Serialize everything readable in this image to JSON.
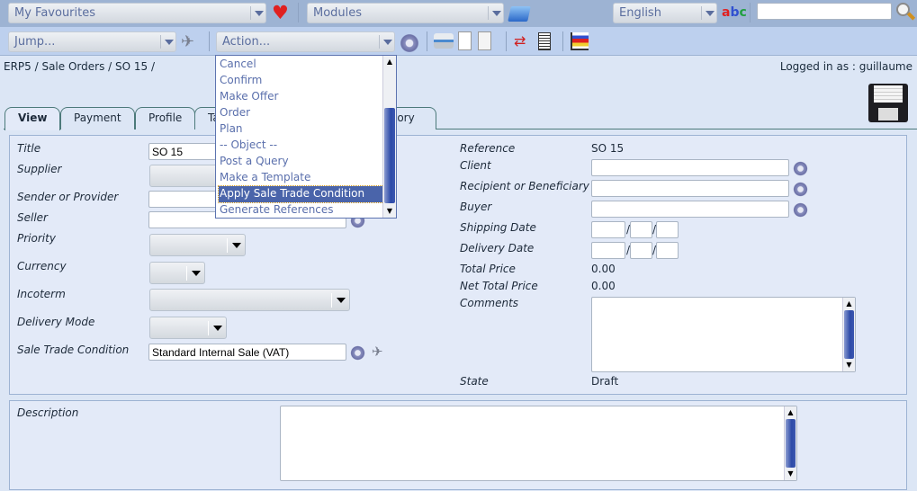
{
  "topbar": {
    "favourites": "My Favourites",
    "modules": "Modules",
    "language": "English",
    "search_value": ""
  },
  "toolbar": {
    "jump": "Jump...",
    "action": "Action..."
  },
  "breadcrumb": "ERP5 / Sale Orders / SO 15 /",
  "logged_in": "Logged in as : guillaume",
  "tabs": [
    {
      "label": "View",
      "active": true
    },
    {
      "label": "Payment"
    },
    {
      "label": "Profile"
    },
    {
      "label": "Ta"
    },
    {
      "label": "History"
    }
  ],
  "action_menu": {
    "items": [
      "Cancel",
      "Confirm",
      "Make Offer",
      "Order",
      "Plan",
      "-- Object --",
      "Post a Query",
      "Make a Template",
      "Apply Sale Trade Condition",
      "Generate References"
    ],
    "selected": "Apply Sale Trade Condition"
  },
  "form_left": {
    "title_label": "Title",
    "title_value": "SO 15",
    "supplier_label": "Supplier",
    "sender_label": "Sender or Provider",
    "seller_label": "Seller",
    "priority_label": "Priority",
    "currency_label": "Currency",
    "incoterm_label": "Incoterm",
    "delivery_mode_label": "Delivery Mode",
    "stc_label": "Sale Trade Condition",
    "stc_value": "Standard Internal Sale (VAT)"
  },
  "form_right": {
    "reference_label": "Reference",
    "reference_value": "SO 15",
    "client_label": "Client",
    "recipient_label": "Recipient or Beneficiary",
    "buyer_label": "Buyer",
    "shipping_label": "Shipping Date",
    "delivery_label": "Delivery Date",
    "date_sep": "/",
    "total_label": "Total Price",
    "total_value": "0.00",
    "net_label": "Net Total Price",
    "net_value": "0.00",
    "comments_label": "Comments",
    "state_label": "State",
    "state_value": "Draft"
  },
  "description_label": "Description",
  "colors": {
    "topbar": "#9db3d3",
    "toolbar": "#bdd0ee",
    "background": "#dce6f5",
    "highlight": "#4a64aa"
  }
}
